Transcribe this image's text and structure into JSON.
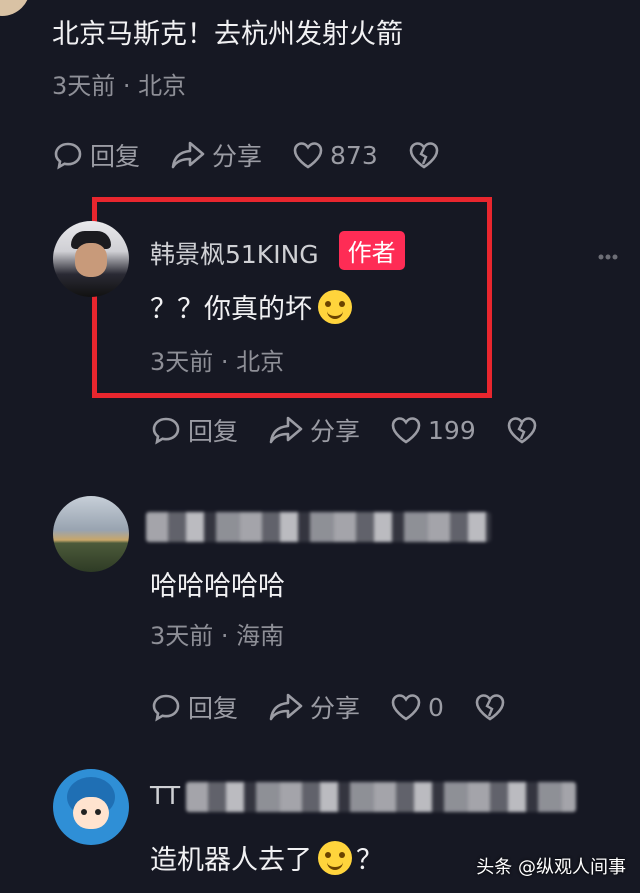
{
  "comments": [
    {
      "text": "北京马斯克！去杭州发射火箭",
      "meta": "3天前 · 北京",
      "reply": "回复",
      "share": "分享",
      "likes": "873"
    },
    {
      "username": "韩景枫51KING",
      "badge": "作者",
      "text": "？？你真的坏",
      "meta": "3天前 · 北京",
      "reply": "回复",
      "share": "分享",
      "likes": "199"
    },
    {
      "text": "哈哈哈哈哈",
      "meta": "3天前 · 海南",
      "reply": "回复",
      "share": "分享",
      "likes": "0"
    },
    {
      "username": "TT",
      "text": "造机器人去了",
      "text_suffix": "？"
    }
  ],
  "watermark": "头条 @纵观人间事",
  "colors": {
    "background": "#161823",
    "badge": "#fe2c55",
    "highlight_border": "#e8262e"
  }
}
